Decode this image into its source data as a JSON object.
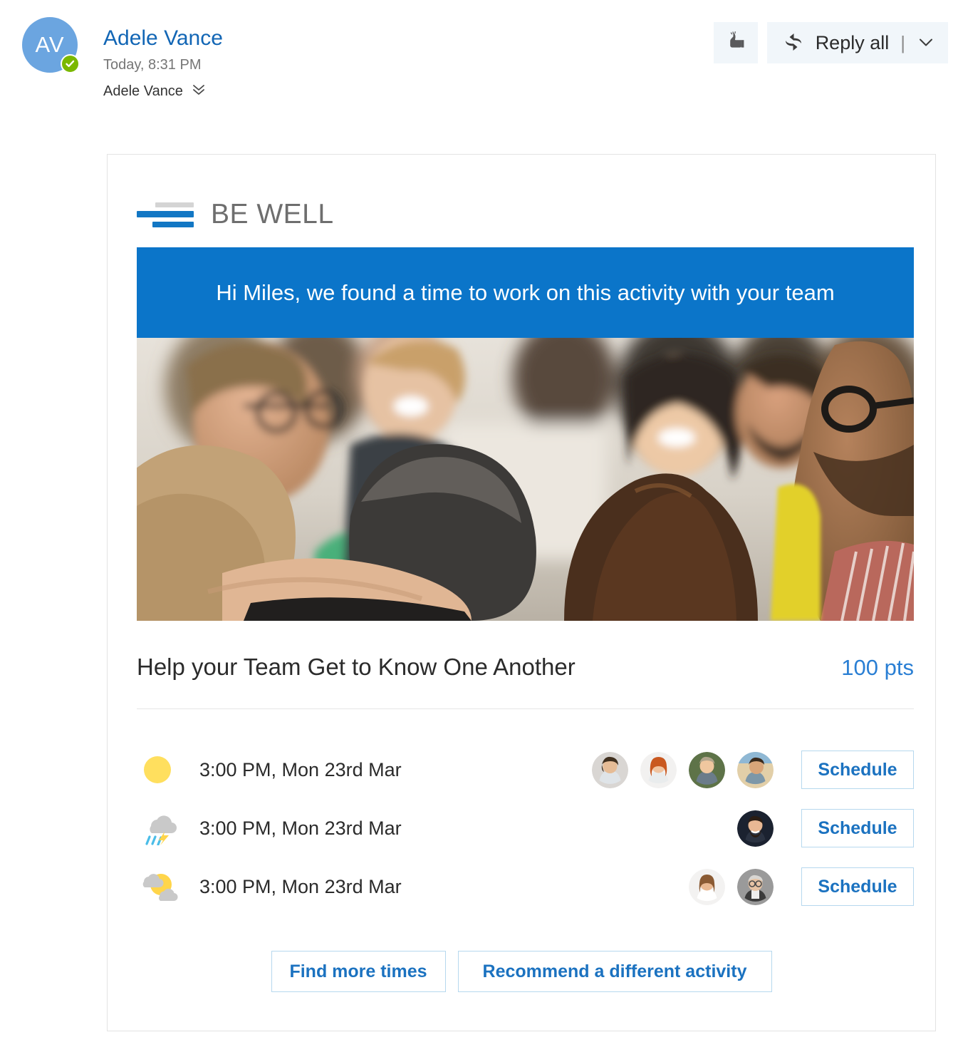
{
  "message": {
    "avatar_initials": "AV",
    "sender": "Adele Vance",
    "timestamp": "Today, 8:31 PM",
    "recipient": "Adele Vance",
    "presence_icon": "available-check-icon",
    "expand_icon": "chevron-double-down-icon"
  },
  "actions": {
    "like_icon": "thumbs-up-icon",
    "reply_icon": "reply-all-icon",
    "reply_label": "Reply all",
    "separator": "|",
    "dropdown_icon": "chevron-down-icon"
  },
  "card": {
    "logo_text": "BE WELL",
    "banner_text": "Hi Miles, we found a time to work on this activity with your team",
    "hero_alt": "group-photo",
    "activity_title": "Help your Team Get to Know One Another",
    "points": "100 pts",
    "slots": [
      {
        "weather_icon": "sunny-icon",
        "time": "3:00 PM, Mon 23rd Mar",
        "attendees": [
          "attendee-1",
          "attendee-2",
          "attendee-3",
          "attendee-4"
        ],
        "button_label": "Schedule"
      },
      {
        "weather_icon": "thunderstorm-rain-icon",
        "time": "3:00 PM, Mon 23rd Mar",
        "attendees": [
          "attendee-5"
        ],
        "button_label": "Schedule"
      },
      {
        "weather_icon": "partly-sunny-icon",
        "time": "3:00 PM, Mon 23rd Mar",
        "attendees": [
          "attendee-6",
          "attendee-7"
        ],
        "button_label": "Schedule"
      }
    ],
    "find_more_times_label": "Find more times",
    "recommend_activity_label": "Recommend a different activity"
  },
  "colors": {
    "brand_blue": "#0b75c9",
    "link_blue": "#1b72c0",
    "sender_blue": "#1266b5",
    "points_blue": "#2a7fd4",
    "presence_green": "#7ab800",
    "avatar_blue": "#6ba5e0",
    "button_border": "#b6d8ee",
    "card_border": "#e3e3e3",
    "divider": "#e6e6e6",
    "action_bg": "#f1f6fa"
  }
}
